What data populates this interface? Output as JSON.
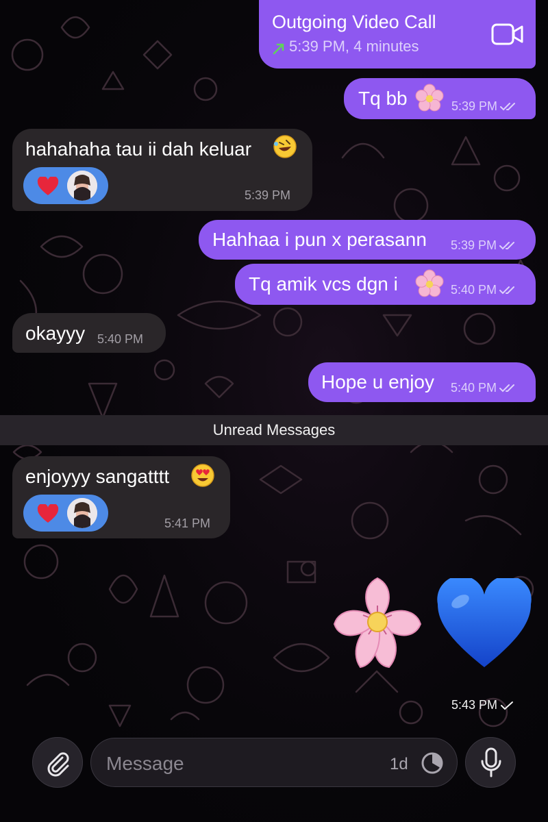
{
  "call": {
    "title": "Outgoing Video Call",
    "details": "5:39 PM, 4 minutes",
    "icon": "video-camera-icon",
    "arrow_icon": "outgoing-arrow-icon"
  },
  "messages": [
    {
      "direction": "outgoing",
      "text": "Tq bb",
      "emoji": "cherry-blossom",
      "time": "5:39 PM",
      "status": "read"
    },
    {
      "direction": "incoming",
      "text": "hahahaha tau ii dah keluar",
      "emoji": "rolling-on-floor-laughing",
      "time": "5:39 PM",
      "reaction": "heart"
    },
    {
      "direction": "outgoing",
      "text": "Hahhaa i pun x perasann",
      "time": "5:39 PM",
      "status": "read"
    },
    {
      "direction": "outgoing",
      "text": "Tq amik vcs dgn i",
      "emoji": "cherry-blossom",
      "time": "5:40 PM",
      "status": "read"
    },
    {
      "direction": "incoming",
      "text": "okayyy",
      "time": "5:40 PM"
    },
    {
      "direction": "outgoing",
      "text": "Hope u enjoy",
      "time": "5:40 PM",
      "status": "read"
    },
    {
      "direction": "incoming",
      "text": "enjoyyy sangatttt",
      "emoji": "smiling-face-with-heart-eyes",
      "time": "5:41 PM",
      "reaction": "heart"
    },
    {
      "direction": "outgoing",
      "type": "emoji-only",
      "emojis": [
        "cherry-blossom",
        "blue-heart"
      ],
      "time": "5:43 PM",
      "status": "sent"
    }
  ],
  "divider": {
    "label": "Unread Messages"
  },
  "composer": {
    "placeholder": "Message",
    "timer_label": "1d",
    "attach_icon": "paperclip-icon",
    "timer_icon": "timer-icon",
    "mic_icon": "microphone-icon"
  },
  "colors": {
    "outgoing_bubble": "#8e58f0",
    "incoming_bubble": "#2a2629",
    "reaction_pill": "#4d8ae6",
    "background": "#060508"
  }
}
